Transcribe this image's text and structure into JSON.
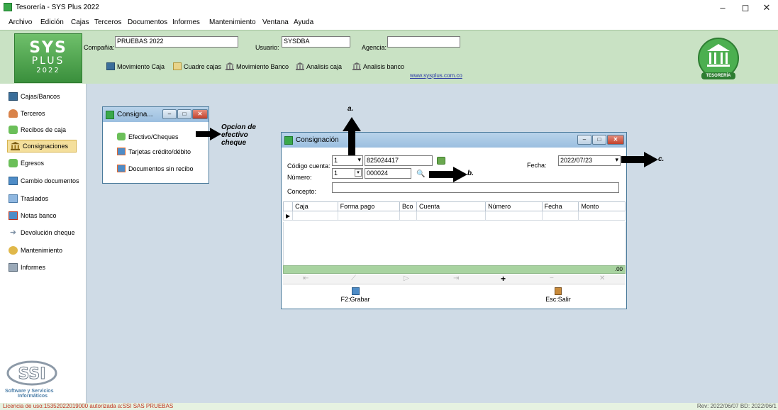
{
  "window": {
    "title": "Tesorería - SYS Plus 2022",
    "minimize": "–",
    "maximize": "◻",
    "close": "✕"
  },
  "menu": [
    "Archivo",
    "Edición",
    "Cajas",
    "Terceros",
    "Documentos",
    "Informes",
    "Mantenimiento",
    "Ventana",
    "Ayuda"
  ],
  "logo": {
    "line1": "SYS",
    "line2": "PLUS",
    "line3": "2022"
  },
  "header": {
    "compania_label": "Compañia:",
    "compania_value": "PRUEBAS 2022",
    "usuario_label": "Usuario:",
    "usuario_value": "SYSDBA",
    "agencia_label": "Agencia:",
    "agencia_value": "",
    "toolbar": [
      "Movimiento Caja",
      "Cuadre cajas",
      "Movimiento Banco",
      "Analisis caja",
      "Analisis banco"
    ],
    "website": "www.sysplus.com.co",
    "badge": "TESORERÍA"
  },
  "sidebar": [
    "Cajas/Bancos",
    "Terceros",
    "Recibos de caja",
    "Consignaciones",
    "Egresos",
    "Cambio documentos",
    "Traslados",
    "Notas banco",
    "Devolución cheque",
    "Mantenimiento",
    "Informes"
  ],
  "sidebar_active": "Consignaciones",
  "ssi_logo": {
    "line1": "SSI",
    "line2": "Software y Servicios",
    "line3": "Informáticos"
  },
  "submenu_window": {
    "title": "Consigna...",
    "items": [
      "Efectivo/Cheques",
      "Tarjetas crédito/débito",
      "Documentos sin recibo"
    ]
  },
  "annotation_option": "Opcion de efectivo cheque",
  "dialog": {
    "title": "Consignación",
    "codigo_label": "Código cuenta:",
    "codigo_value": "1",
    "codigo_account": "825024417",
    "fecha_label": "Fecha:",
    "fecha_value": "2022/07/23",
    "numero_label": "Número:",
    "numero_value": "1",
    "numero_doc": "000024",
    "concepto_label": "Concepto:",
    "concepto_value": "",
    "columns": [
      "Caja",
      "Forma pago",
      "Bco",
      "Cuenta",
      "Número",
      "Fecha",
      "Monto"
    ],
    "total": ".00",
    "grabar": "F2:Grabar",
    "salir": "Esc:Salir"
  },
  "annotations": {
    "a": "a.",
    "b": "b.",
    "c": "c."
  },
  "status": {
    "license": "Licencia de uso:15352022019000 autorizada a:SSI SAS PRUEBAS",
    "rev": "Rev: 2022/06/07 BD: 2022/06/1"
  }
}
